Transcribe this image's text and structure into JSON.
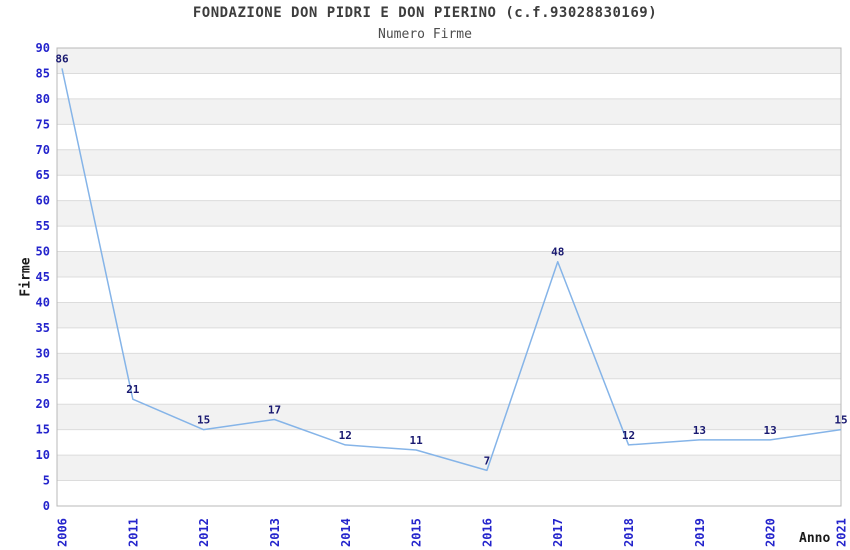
{
  "chart_data": {
    "type": "line",
    "title": "FONDAZIONE DON PIDRI E DON PIERINO (c.f.93028830169)",
    "subtitle": "Numero Firme",
    "xlabel": "Anno",
    "ylabel": "Firme",
    "categories": [
      "2006",
      "2011",
      "2012",
      "2013",
      "2014",
      "2015",
      "2016",
      "2017",
      "2018",
      "2019",
      "2020",
      "2021"
    ],
    "series": [
      {
        "name": "Numero Firme",
        "values": [
          86,
          21,
          15,
          17,
          12,
          11,
          7,
          48,
          12,
          13,
          13,
          15
        ]
      }
    ],
    "ylim": [
      0,
      90
    ],
    "ytick_step": 5,
    "grid": true,
    "banded_background": true,
    "legend_position": "none",
    "data_labels_visible": true,
    "colors": {
      "line": "#85b4e8",
      "tick_label": "#2424cc",
      "data_label": "#191970",
      "band": "#f2f2f2",
      "gridline": "#dcdcdc",
      "plot_border": "#b8b8b8",
      "title": "#3d3d3d",
      "subtitle": "#4d4d4d",
      "axis_label": "#1a1a1a"
    }
  }
}
